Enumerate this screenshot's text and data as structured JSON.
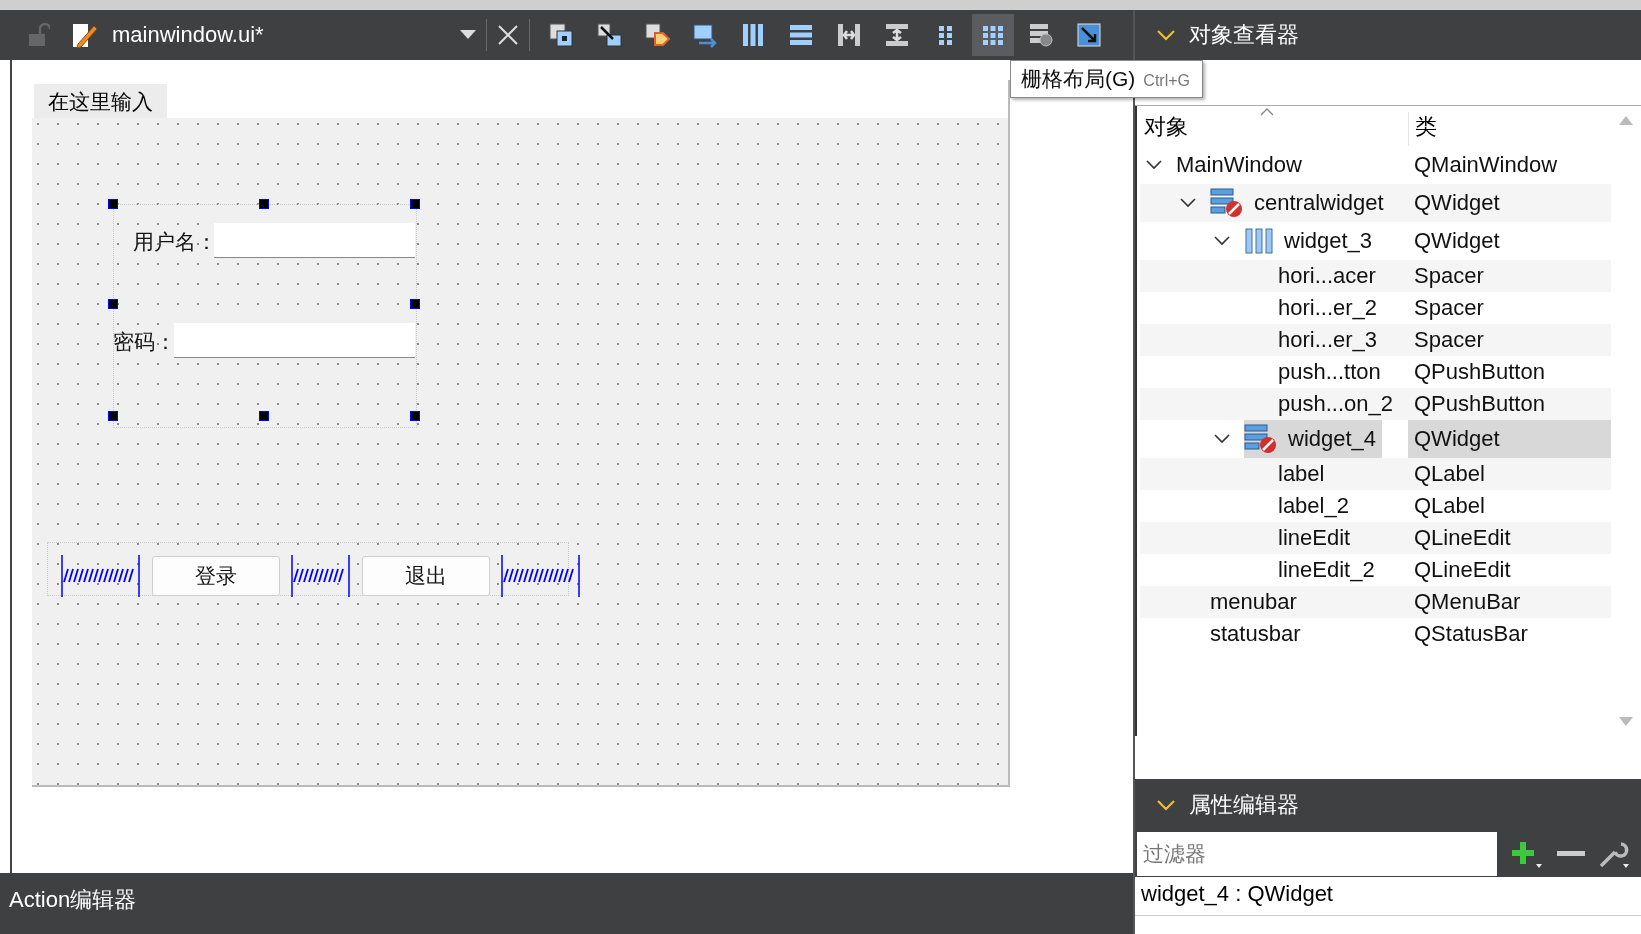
{
  "toolbar": {
    "file_name": "mainwindow.ui*",
    "tools": [
      {
        "kind": "edit_widgets",
        "selected": false
      },
      {
        "kind": "edit_signals",
        "selected": false
      },
      {
        "kind": "edit_buddies",
        "selected": false
      },
      {
        "kind": "edit_tab_order",
        "selected": false
      },
      {
        "kind": "hlayout",
        "selected": false
      },
      {
        "kind": "vlayout",
        "selected": false
      },
      {
        "kind": "hsplit",
        "selected": false
      },
      {
        "kind": "vsplit",
        "selected": false
      },
      {
        "kind": "form_layout",
        "selected": false
      },
      {
        "kind": "grid_layout",
        "selected": true
      },
      {
        "kind": "break_layout",
        "selected": false
      },
      {
        "kind": "adjust_size",
        "selected": false
      }
    ]
  },
  "tooltip": {
    "label": "栅格布局(G)",
    "shortcut": "Ctrl+G"
  },
  "form": {
    "menu_item": "在这里输入",
    "fields": [
      {
        "label": "用户名："
      },
      {
        "label": "密码："
      }
    ],
    "buttons": [
      "登录",
      "退出"
    ]
  },
  "object_inspector": {
    "title": "对象查看器",
    "columns": [
      "对象",
      "类"
    ],
    "objects": [
      {
        "name": "MainWindow",
        "class": "QMainWindow",
        "expanded": true,
        "selected": false,
        "children": [
          {
            "name": "centralwidget",
            "class": "QWidget",
            "kind": "broken_layout",
            "expanded": true,
            "selected": false,
            "children": [
              {
                "name": "widget_3",
                "class": "QWidget",
                "kind": "hbox",
                "expanded": true,
                "selected": false,
                "children": [
                  {
                    "name": "hori...acer",
                    "class": "Spacer",
                    "selected": false
                  },
                  {
                    "name": "hori...er_2",
                    "class": "Spacer",
                    "selected": false
                  },
                  {
                    "name": "hori...er_3",
                    "class": "Spacer",
                    "selected": false
                  },
                  {
                    "name": "push...tton",
                    "class": "QPushButton",
                    "selected": false
                  },
                  {
                    "name": "push...on_2",
                    "class": "QPushButton",
                    "selected": false
                  }
                ]
              },
              {
                "name": "widget_4",
                "class": "QWidget",
                "kind": "broken_layout",
                "expanded": true,
                "selected": true,
                "children": [
                  {
                    "name": "label",
                    "class": "QLabel",
                    "selected": false
                  },
                  {
                    "name": "label_2",
                    "class": "QLabel",
                    "selected": false
                  },
                  {
                    "name": "lineEdit",
                    "class": "QLineEdit",
                    "selected": false
                  },
                  {
                    "name": "lineEdit_2",
                    "class": "QLineEdit",
                    "selected": false
                  }
                ]
              }
            ]
          },
          {
            "name": "menubar",
            "class": "QMenuBar",
            "selected": false
          },
          {
            "name": "statusbar",
            "class": "QStatusBar",
            "selected": false
          }
        ]
      }
    ]
  },
  "property_editor": {
    "title": "属性编辑器",
    "filter_placeholder": "过滤器",
    "current_object": "widget_4 : QWidget"
  },
  "action_editor": {
    "title": "Action编辑器"
  }
}
